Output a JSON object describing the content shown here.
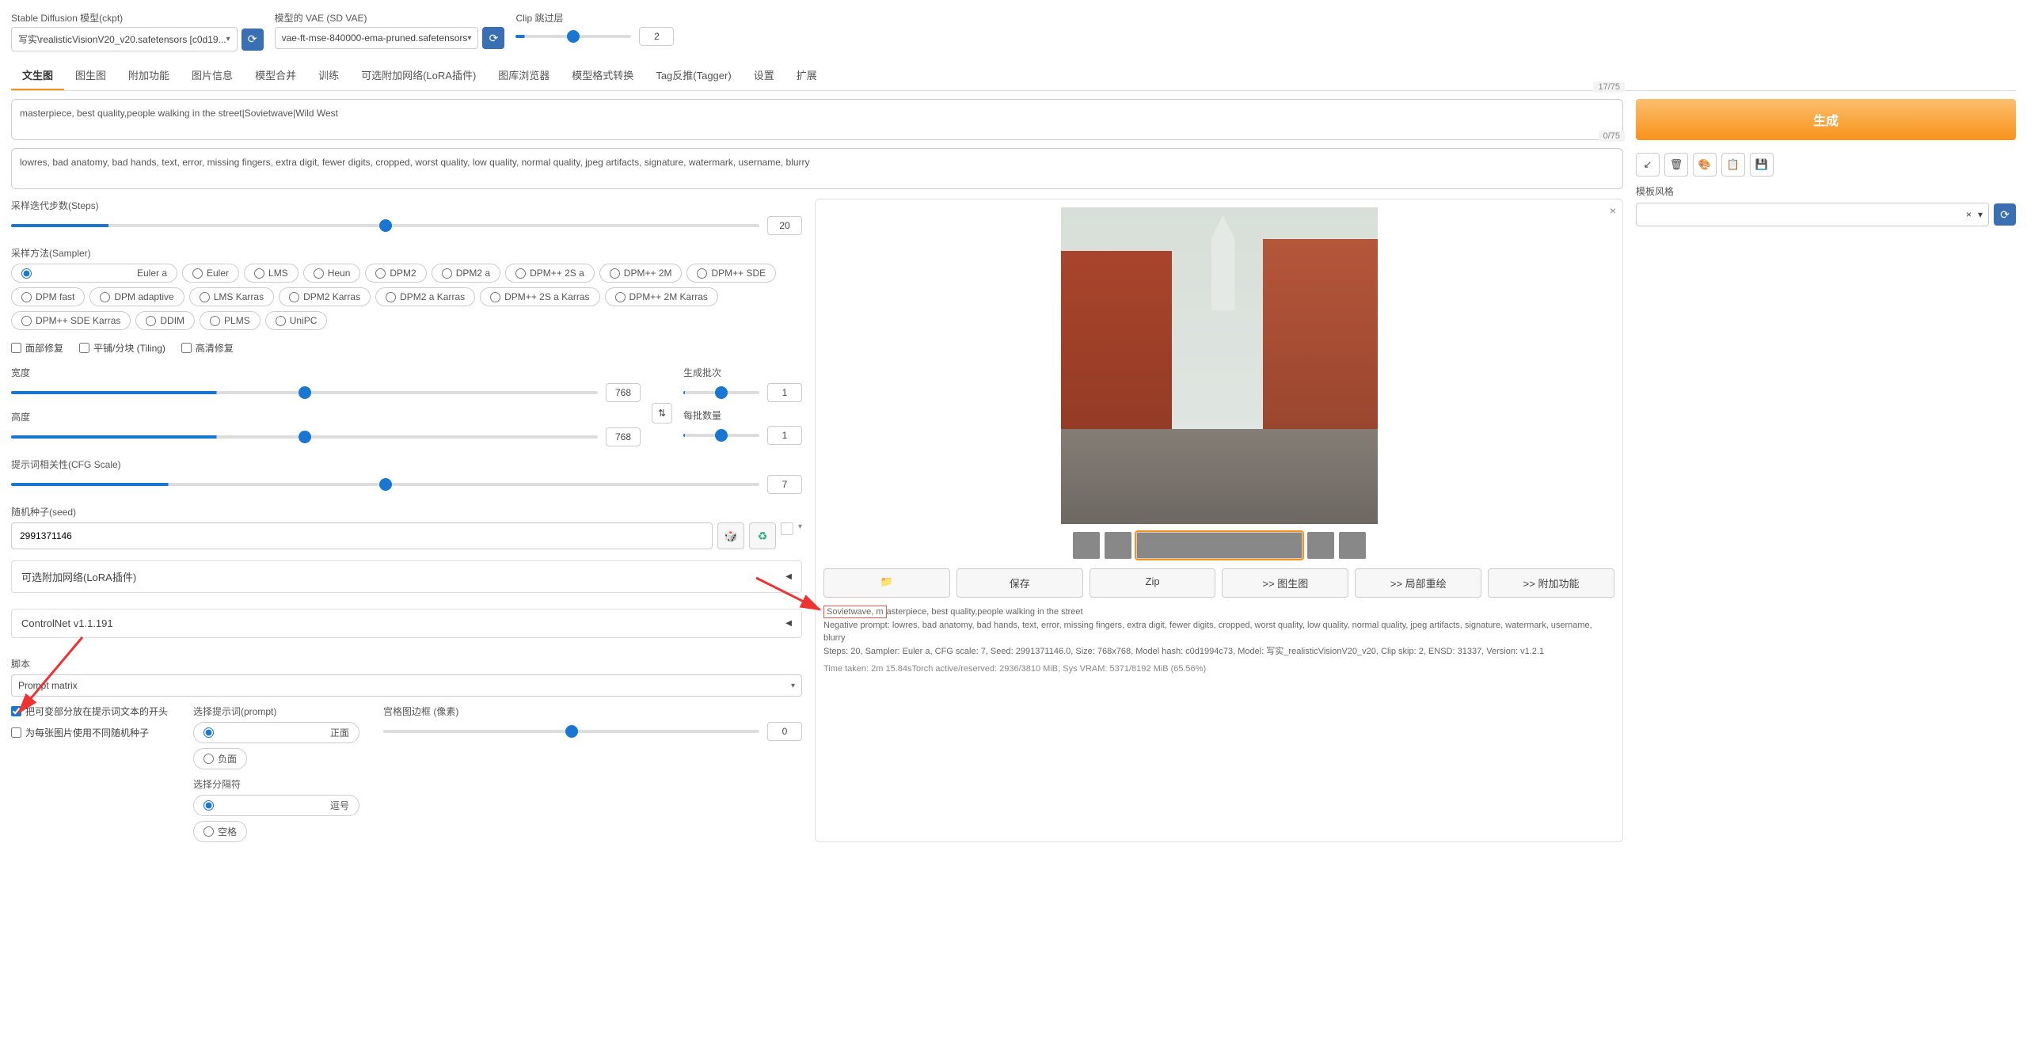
{
  "top": {
    "ckpt_label": "Stable Diffusion 模型(ckpt)",
    "ckpt_value": "写实\\realisticVisionV20_v20.safetensors [c0d19...",
    "vae_label": "模型的 VAE (SD VAE)",
    "vae_value": "vae-ft-mse-840000-ema-pruned.safetensors",
    "clip_label": "Clip 跳过层",
    "clip_value": "2"
  },
  "tabs": [
    "文生图",
    "图生图",
    "附加功能",
    "图片信息",
    "模型合并",
    "训练",
    "可选附加网络(LoRA插件)",
    "图库浏览器",
    "模型格式转换",
    "Tag反推(Tagger)",
    "设置",
    "扩展"
  ],
  "active_tab": 0,
  "prompt": {
    "pos": "masterpiece, best quality,people walking in the street|Sovietwave|Wild West",
    "pos_count": "17/75",
    "neg": "lowres, bad anatomy, bad hands, text, error, missing fingers, extra digit, fewer digits, cropped, worst quality, low quality, normal quality, jpeg artifacts, signature, watermark, username, blurry",
    "neg_count": "0/75"
  },
  "steps": {
    "label": "采样迭代步数(Steps)",
    "value": "20"
  },
  "sampler": {
    "label": "采样方法(Sampler)",
    "opts": [
      "Euler a",
      "Euler",
      "LMS",
      "Heun",
      "DPM2",
      "DPM2 a",
      "DPM++ 2S a",
      "DPM++ 2M",
      "DPM++ SDE",
      "DPM fast",
      "DPM adaptive",
      "LMS Karras",
      "DPM2 Karras",
      "DPM2 a Karras",
      "DPM++ 2S a Karras",
      "DPM++ 2M Karras",
      "DPM++ SDE Karras",
      "DDIM",
      "PLMS",
      "UniPC"
    ],
    "sel": "Euler a"
  },
  "restore": {
    "face": "面部修复",
    "tile": "平铺/分块 (Tiling)",
    "hires": "高清修复"
  },
  "dims": {
    "width_label": "宽度",
    "width": "768",
    "height_label": "高度",
    "height": "768",
    "batch_count_label": "生成批次",
    "batch_count": "1",
    "batch_size_label": "每批数量",
    "batch_size": "1",
    "swap_icon": "⇅"
  },
  "cfg": {
    "label": "提示词相关性(CFG Scale)",
    "value": "7"
  },
  "seed": {
    "label": "随机种子(seed)",
    "value": "2991371146",
    "dice": "🎲",
    "recycle": "♻"
  },
  "extras": {
    "lora": "可选附加网络(LoRA插件)",
    "cnet": "ControlNet v1.1.191"
  },
  "script": {
    "label": "脚本",
    "value": "Prompt matrix",
    "chk1": "把可变部分放在提示词文本的开头",
    "chk2": "为每张图片使用不同随机种子",
    "prompt_sel_label": "选择提示词(prompt)",
    "prompt_opt_pos": "正面",
    "prompt_opt_neg": "负面",
    "delim_label": "选择分隔符",
    "delim_comma": "逗号",
    "delim_space": "空格",
    "margin_label": "宫格图边框 (像素)",
    "margin_value": "0"
  },
  "right": {
    "generate": "生成",
    "style_label": "模板风格",
    "style_clear": "×",
    "style_chev": "▾"
  },
  "output": {
    "thumbs": 5,
    "thumb_selected": 2,
    "buttons": {
      "folder": "📁",
      "save": "保存",
      "zip": "Zip",
      "img2img": ">> 图生图",
      "inpaint": ">> 局部重绘",
      "extras": ">> 附加功能"
    },
    "meta_prefix": "Sovietwave, m",
    "meta_rest": "asterpiece, best quality,people walking in the street",
    "neg_line": "Negative prompt: lowres, bad anatomy, bad hands, text, error, missing fingers, extra digit, fewer digits, cropped, worst quality, low quality, normal quality, jpeg artifacts, signature, watermark, username, blurry",
    "params_line": "Steps: 20, Sampler: Euler a, CFG scale: 7, Seed: 2991371146.0, Size: 768x768, Model hash: c0d1994c73, Model: 写实_realisticVisionV20_v20, Clip skip: 2, ENSD: 31337, Version: v1.2.1",
    "time_line": "Time taken: 2m 15.84sTorch active/reserved: 2936/3810 MiB, Sys VRAM: 5371/8192 MiB (65.56%)"
  }
}
